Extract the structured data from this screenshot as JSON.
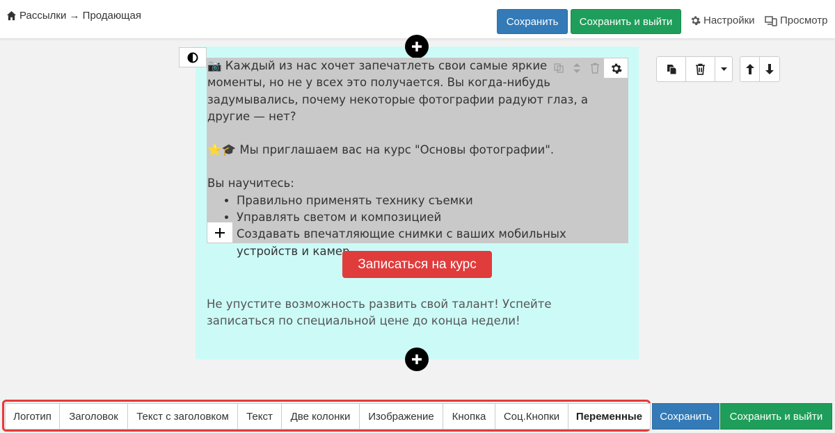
{
  "header": {
    "breadcrumb": "Рассылки → Продающая",
    "save_label": "Сохранить",
    "save_exit_label": "Сохранить и выйти",
    "settings_label": "Настройки",
    "preview_label": "Просмотр"
  },
  "content": {
    "paragraph1": "Каждый из нас хочет запечатлеть свои самые яркие моменты, но не у всех это получается. Вы когда-нибудь задумывались, почему некоторые фотографии радуют глаз, а другие — нет?",
    "paragraph2": "Мы приглашаем вас на курс \"Основы фотографии\".",
    "learn_heading": "Вы научитесь:",
    "list": [
      "Правильно применять технику съемки",
      "Управлять светом и композицией",
      "Создавать впечатляющие снимки с ваших мобильных устройств и камер"
    ],
    "cta_label": "Записаться на курс",
    "footer": "Не упустите возможность развить свой талант! Успейте записаться по специальной цене до конца недели!"
  },
  "blocks": [
    "Логотип",
    "Заголовок",
    "Текст с заголовком",
    "Текст",
    "Две колонки",
    "Изображение",
    "Кнопка",
    "Соц.Кнопки",
    "Переменные"
  ],
  "footer_bar": {
    "save_label": "Сохранить",
    "save_exit_label": "Сохранить и выйти"
  },
  "colors": {
    "primary": "#337ab7",
    "success": "#1e9e5a",
    "cta": "#e03c3c",
    "block_bg": "#ccfbf7",
    "highlight": "#e23b3b"
  }
}
